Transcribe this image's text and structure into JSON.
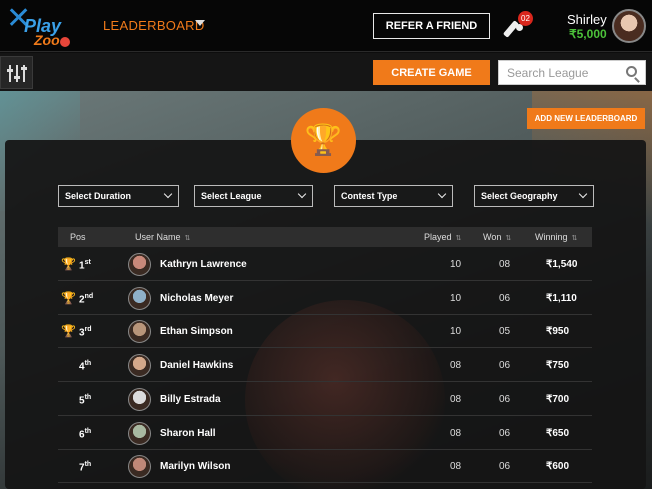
{
  "header": {
    "logo_primary": "Play",
    "logo_secondary": "Zoo",
    "nav_label": "LEADERBOARD",
    "refer_label": "REFER A FRIEND",
    "notification_count": "02",
    "user_name": "Shirley",
    "user_balance": "₹5,000"
  },
  "toolbar": {
    "create_label": "CREATE GAME",
    "search_placeholder": "Search League"
  },
  "main": {
    "add_leaderboard_label": "ADD NEW LEADERBOARD",
    "filters": [
      "Select Duration",
      "Select League",
      "Contest Type",
      "Select Geography"
    ],
    "columns": {
      "pos": "Pos",
      "user": "User Name",
      "played": "Played",
      "won": "Won",
      "winning": "Winning"
    },
    "rows": [
      {
        "pos": "1",
        "suffix": "st",
        "name": "Kathryn Lawrence",
        "played": "10",
        "won": "08",
        "winning": "₹1,540",
        "trophy": "gold"
      },
      {
        "pos": "2",
        "suffix": "nd",
        "name": "Nicholas Meyer",
        "played": "10",
        "won": "06",
        "winning": "₹1,110",
        "trophy": "silver"
      },
      {
        "pos": "3",
        "suffix": "rd",
        "name": "Ethan Simpson",
        "played": "10",
        "won": "05",
        "winning": "₹950",
        "trophy": "bronze"
      },
      {
        "pos": "4",
        "suffix": "th",
        "name": "Daniel Hawkins",
        "played": "08",
        "won": "06",
        "winning": "₹750",
        "trophy": ""
      },
      {
        "pos": "5",
        "suffix": "th",
        "name": "Billy Estrada",
        "played": "08",
        "won": "06",
        "winning": "₹700",
        "trophy": ""
      },
      {
        "pos": "6",
        "suffix": "th",
        "name": "Sharon Hall",
        "played": "08",
        "won": "06",
        "winning": "₹650",
        "trophy": ""
      },
      {
        "pos": "7",
        "suffix": "th",
        "name": "Marilyn Wilson",
        "played": "08",
        "won": "06",
        "winning": "₹600",
        "trophy": ""
      }
    ]
  },
  "colors": {
    "accent": "#f07a1a",
    "balance": "#4cc23a",
    "badge": "#d9261c",
    "gold": "#d4a017",
    "silver": "#c0c0c0",
    "bronze": "#b8733a"
  },
  "icons": [
    "filter-sliders-icon",
    "search-icon",
    "trophy-icon",
    "cricket-bat-icon",
    "chevron-down-icon",
    "sort-icon"
  ]
}
